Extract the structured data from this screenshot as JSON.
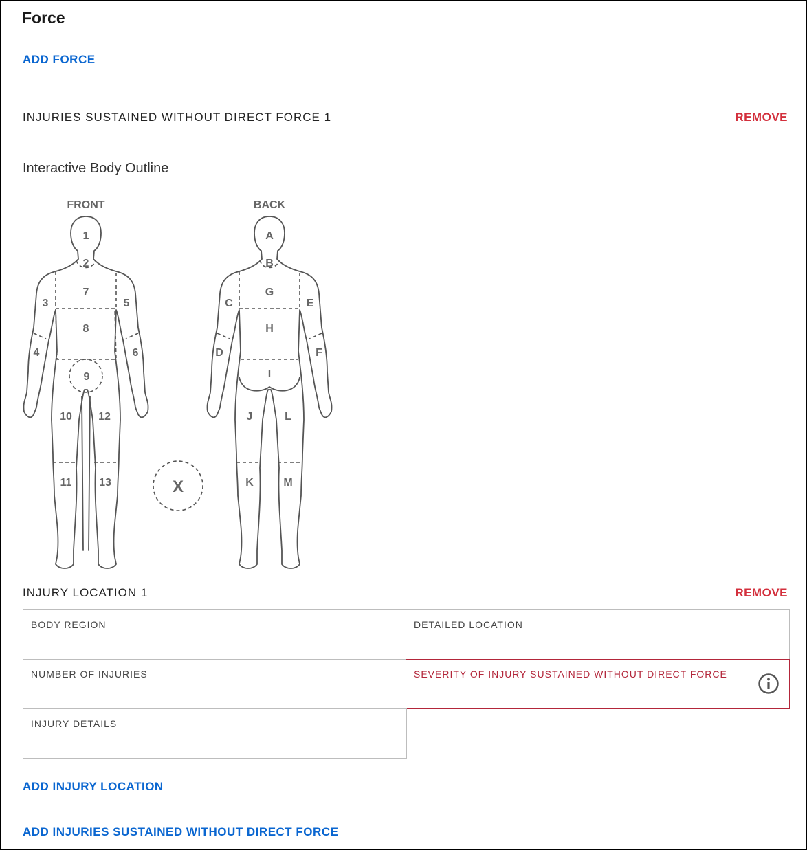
{
  "section": {
    "title": "Force"
  },
  "add_force_label": "ADD FORCE",
  "injury_group": {
    "title": "INJURIES SUSTAINED WITHOUT DIRECT FORCE 1",
    "remove_label": "REMOVE",
    "outline_title": "Interactive Body Outline",
    "front_label": "FRONT",
    "back_label": "BACK",
    "front_regions": [
      "1",
      "2",
      "3",
      "4",
      "5",
      "6",
      "7",
      "8",
      "9",
      "10",
      "11",
      "12",
      "13"
    ],
    "back_regions": [
      "A",
      "B",
      "C",
      "D",
      "E",
      "F",
      "G",
      "H",
      "I",
      "J",
      "K",
      "L",
      "M"
    ],
    "other_region": "X"
  },
  "injury_location": {
    "title": "INJURY LOCATION 1",
    "remove_label": "REMOVE",
    "fields": {
      "body_region": "BODY REGION",
      "detailed_location": "DETAILED LOCATION",
      "number_of_injuries": "NUMBER OF INJURIES",
      "severity": "SEVERITY OF INJURY SUSTAINED WITHOUT DIRECT FORCE",
      "injury_details": "INJURY DETAILS"
    }
  },
  "add_injury_location_label": "ADD INJURY LOCATION",
  "add_injuries_label": "ADD INJURIES SUSTAINED WITHOUT DIRECT FORCE",
  "colors": {
    "link": "#0a66d0",
    "remove": "#d32f3c",
    "error": "#b3263a"
  },
  "icons": {
    "severity_info": "info-icon"
  }
}
